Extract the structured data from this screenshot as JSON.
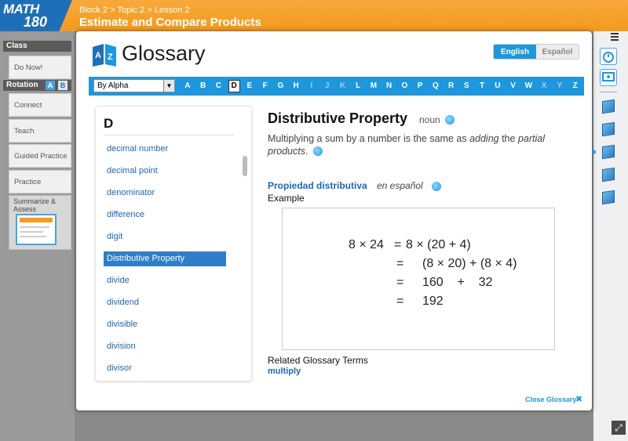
{
  "app": {
    "logo_top": "MATH",
    "logo_bottom": "180",
    "breadcrumb": "Block 2 > Topic 2 > Lesson 2",
    "lesson_title": "Estimate and Compare Products"
  },
  "left_nav": {
    "class_header": "Class",
    "rotation_header": "Rotation",
    "rotation_a": "A",
    "rotation_b": "B",
    "items": [
      {
        "label": "Do Now!"
      },
      {
        "label": "Connect"
      },
      {
        "label": "Teach"
      },
      {
        "label": "Guided Practice"
      },
      {
        "label": "Practice"
      }
    ],
    "summarize_label": "Summarize & Assess"
  },
  "glossary": {
    "title": "Glossary",
    "lang_english": "English",
    "lang_spanish": "Español",
    "sort_select": "By Alpha",
    "letters": [
      {
        "l": "A",
        "disabled": false
      },
      {
        "l": "B",
        "disabled": false
      },
      {
        "l": "C",
        "disabled": false
      },
      {
        "l": "D",
        "disabled": false,
        "active": true
      },
      {
        "l": "E",
        "disabled": false
      },
      {
        "l": "F",
        "disabled": false
      },
      {
        "l": "G",
        "disabled": false
      },
      {
        "l": "H",
        "disabled": false
      },
      {
        "l": "I",
        "disabled": true
      },
      {
        "l": "J",
        "disabled": true
      },
      {
        "l": "K",
        "disabled": true
      },
      {
        "l": "L",
        "disabled": false
      },
      {
        "l": "M",
        "disabled": false
      },
      {
        "l": "N",
        "disabled": false
      },
      {
        "l": "O",
        "disabled": false
      },
      {
        "l": "P",
        "disabled": false
      },
      {
        "l": "Q",
        "disabled": false
      },
      {
        "l": "R",
        "disabled": false
      },
      {
        "l": "S",
        "disabled": false
      },
      {
        "l": "T",
        "disabled": false
      },
      {
        "l": "U",
        "disabled": false
      },
      {
        "l": "V",
        "disabled": false
      },
      {
        "l": "W",
        "disabled": false
      },
      {
        "l": "X",
        "disabled": true
      },
      {
        "l": "Y",
        "disabled": true
      },
      {
        "l": "Z",
        "disabled": false
      }
    ],
    "list_letter": "D",
    "terms": [
      {
        "t": "decimal number"
      },
      {
        "t": "decimal point"
      },
      {
        "t": "denominator"
      },
      {
        "t": "difference"
      },
      {
        "t": "digit"
      },
      {
        "t": "Distributive Property",
        "selected": true
      },
      {
        "t": "divide"
      },
      {
        "t": "dividend"
      },
      {
        "t": "divisible"
      },
      {
        "t": "division"
      },
      {
        "t": "divisor"
      }
    ],
    "definition": {
      "term": "Distributive Property",
      "part_of_speech": "noun",
      "text_1": "Multiplying a sum by a number is the same as ",
      "text_em1": "adding",
      "text_2": " the ",
      "text_em2": "partial products",
      "text_3": ".",
      "spanish_term": "Propiedad distributiva",
      "spanish_note": "en español",
      "example_label": "Example",
      "example_lines": [
        {
          "left": "8 × 24",
          "eq": "=",
          "right": "8 × (20 + 4)"
        },
        {
          "left": "",
          "eq": "=",
          "right": "(8 × 20) + (8 × 4)"
        },
        {
          "left": "",
          "eq": "=",
          "right": "160    +    32"
        },
        {
          "left": "",
          "eq": "=",
          "right": "192"
        }
      ],
      "related_label": "Related Glossary Terms",
      "related_terms": [
        "multiply"
      ]
    },
    "close_label": "Close Glossary",
    "close_icon": "✖"
  },
  "right_tools": {
    "icons": [
      "menu-icon",
      "timer-icon",
      "whiteboard-icon",
      "cube-icon-1",
      "cube-icon-2",
      "cube-icon-3",
      "cube-icon-4",
      "cube-icon-5"
    ]
  },
  "colors": {
    "header_orange": "#f39a1f",
    "brand_blue": "#1e6fb8",
    "accent_blue": "#1e97dc",
    "link_blue": "#1f66b5"
  }
}
